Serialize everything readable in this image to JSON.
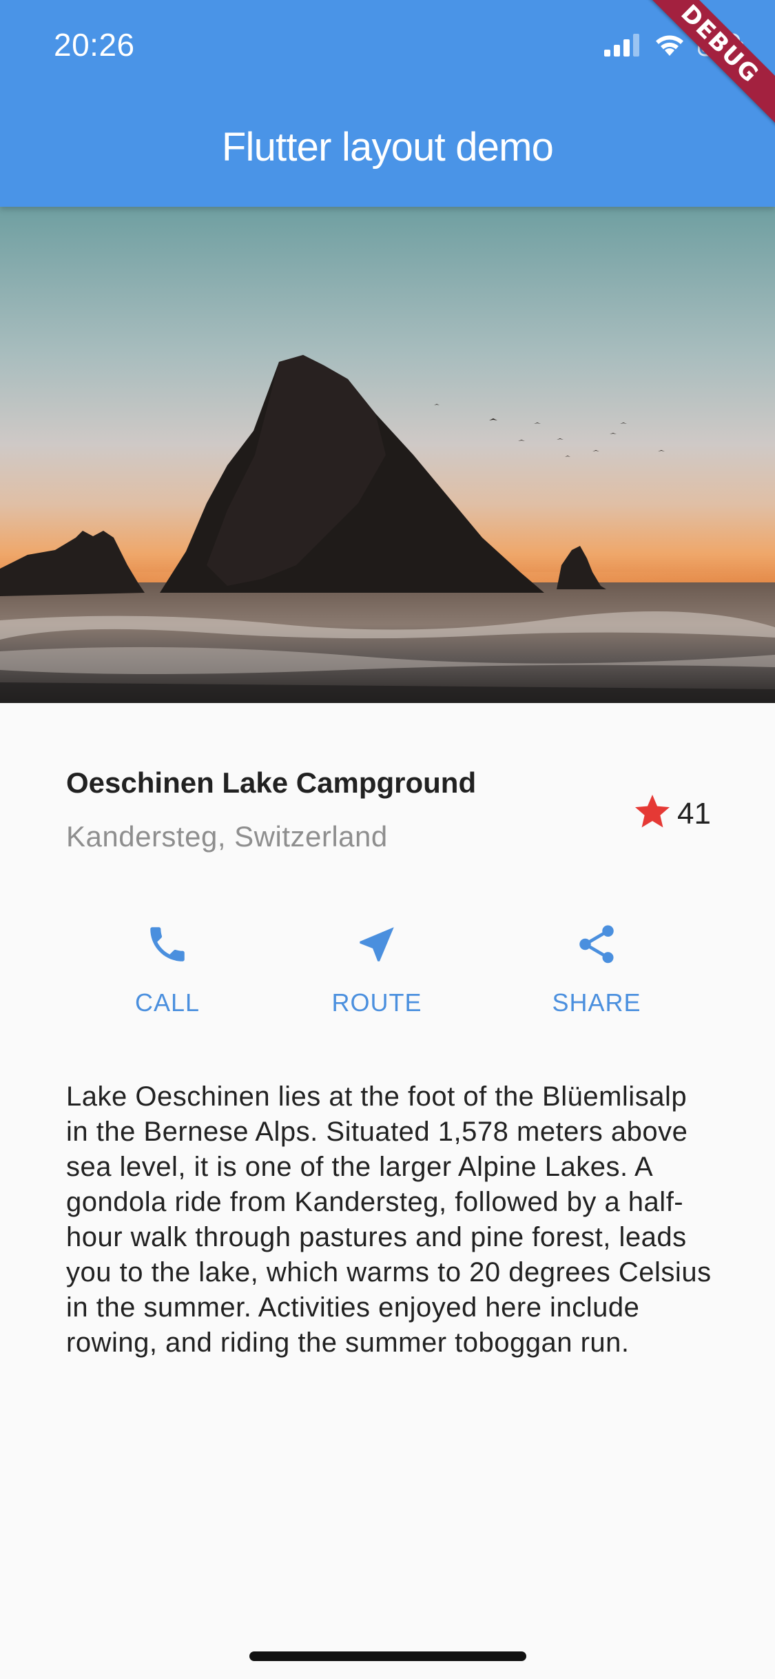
{
  "status_bar": {
    "time": "20:26",
    "icons": [
      "signal-icon",
      "wifi-icon",
      "battery-icon"
    ]
  },
  "debug_banner": "DEBUG",
  "app_bar": {
    "title": "Flutter layout demo",
    "color": "#4a94e7"
  },
  "hero_image": {
    "subject": "rock-formation-sunset-beach-photo"
  },
  "title_section": {
    "name": "Oeschinen Lake Campground",
    "location": "Kandersteg, Switzerland",
    "rating": {
      "icon": "star-icon",
      "count": "41",
      "color": "#e53935"
    }
  },
  "button_section": {
    "accent": "#4a8fde",
    "buttons": [
      {
        "label": "CALL",
        "icon": "phone-icon"
      },
      {
        "label": "ROUTE",
        "icon": "navigation-arrow-icon"
      },
      {
        "label": "SHARE",
        "icon": "share-icon"
      }
    ]
  },
  "description": "Lake Oeschinen lies at the foot of the Blüemlisalp in the Bernese Alps. Situated 1,578 meters above sea level, it is one of the larger Alpine Lakes. A gondola ride from Kandersteg, followed by a half-hour walk through pastures and pine forest, leads you to the lake, which warms to 20 degrees Celsius in the summer. Activities enjoyed here include rowing, and riding the summer toboggan run."
}
